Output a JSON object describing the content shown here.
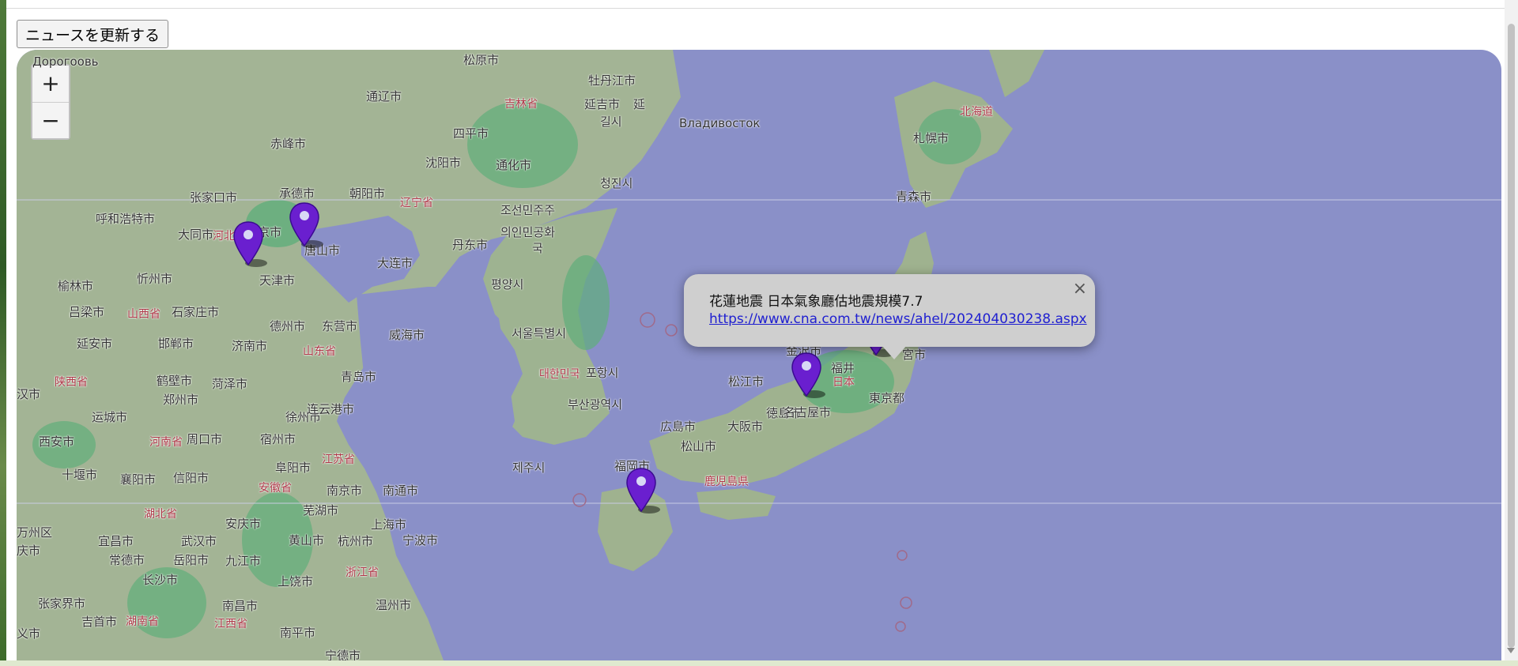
{
  "toolbar": {
    "refresh_label": "ニュースを更新する"
  },
  "map": {
    "zoom_in_label": "+",
    "zoom_out_label": "−",
    "popup": {
      "title": "花蓮地震 日本氣象廳估地震規模7.7",
      "link": "https://www.cna.com.tw/news/ahel/202404030238.aspx",
      "close_label": "×"
    },
    "place_labels": [
      "Дорогоовь",
      "松原市",
      "牡丹江市",
      "通辽市",
      "吉林省",
      "延吉市",
      "延",
      "Владивосток",
      "길시",
      "赤峰市",
      "四平市",
      "沈阳市",
      "通化市",
      "张家口市",
      "承德市",
      "朝阳市",
      "辽宁省",
      "청진시",
      "呼和浩特市",
      "大同市",
      "唐山市",
      "大连市",
      "丹东市",
      "조선민주주",
      "의인민공화",
      "국",
      "北京市",
      "河北",
      "天津市",
      "평양시",
      "榆林市",
      "忻州市",
      "吕梁市",
      "石家庄市",
      "山西省",
      "德州市",
      "东营市",
      "威海市",
      "서울특별시",
      "延安市",
      "邯郸市",
      "济南市",
      "山东省",
      "青岛市",
      "陕西省",
      "鹤壁市",
      "菏泽市",
      "대한민국",
      "포항시",
      "郑州市",
      "运城市",
      "徐州市",
      "连云港市",
      "부산광역시",
      "西安市",
      "河南省",
      "周口市",
      "宿州市",
      "阜阳市",
      "江苏省",
      "十堰市",
      "襄阳市",
      "信阳市",
      "安徽省",
      "南京市",
      "南通市",
      "湖北省",
      "芜湖市",
      "上海市",
      "安庆市",
      "宜昌市",
      "武汉市",
      "黄山市",
      "杭州市",
      "宁波市",
      "常德市",
      "岳阳市",
      "九江市",
      "上饶市",
      "浙江省",
      "长沙市",
      "南昌市",
      "温州市",
      "张家界市",
      "吉首市",
      "湖南省",
      "江西省",
      "南平市",
      "宁德市",
      "제주시",
      "福岡市",
      "鹿児島県",
      "松江市",
      "広島市",
      "大阪市",
      "松山市",
      "徳島市",
      "名古屋市",
      "金沢市",
      "福井",
      "日本",
      "東京都",
      "新",
      "宮市",
      "青森市",
      "札幌市",
      "北海道",
      "万州区",
      "汉市",
      "义市",
      "庆市"
    ],
    "markers": [
      {
        "name": "marker-beijing-area"
      },
      {
        "name": "marker-tangshan-area"
      },
      {
        "name": "marker-kagoshima-area"
      },
      {
        "name": "marker-fukui-area"
      },
      {
        "name": "marker-niigata-area"
      },
      {
        "name": "marker-miyagi-area"
      }
    ],
    "colors": {
      "sea": "#8a90c8",
      "land": "#9fb08f",
      "forest": "#5fae7a",
      "marker": "#6a1fcf",
      "popup_bg": "#cfcfcf",
      "link": "#2020d0"
    }
  }
}
